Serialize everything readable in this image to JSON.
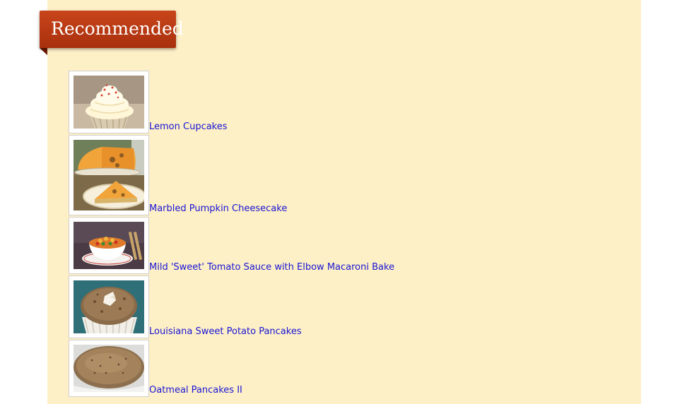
{
  "section": {
    "title": "Recommended"
  },
  "recipes": [
    {
      "title": "Lemon Cupcakes",
      "image": "lemon-cupcake-photo"
    },
    {
      "title": "Marbled Pumpkin Cheesecake",
      "image": "pumpkin-cheesecake-photo"
    },
    {
      "title": "Mild 'Sweet' Tomato Sauce with Elbow Macaroni Bake",
      "image": "macaroni-bowl-photo"
    },
    {
      "title": "Louisiana Sweet Potato Pancakes",
      "image": "sweet-potato-muffin-photo"
    },
    {
      "title": "Oatmeal Pancakes II",
      "image": "oatmeal-pancake-photo"
    }
  ],
  "colors": {
    "panel_background": "#fdefc6",
    "ribbon": "#b83a12",
    "link": "#1a16d6"
  }
}
